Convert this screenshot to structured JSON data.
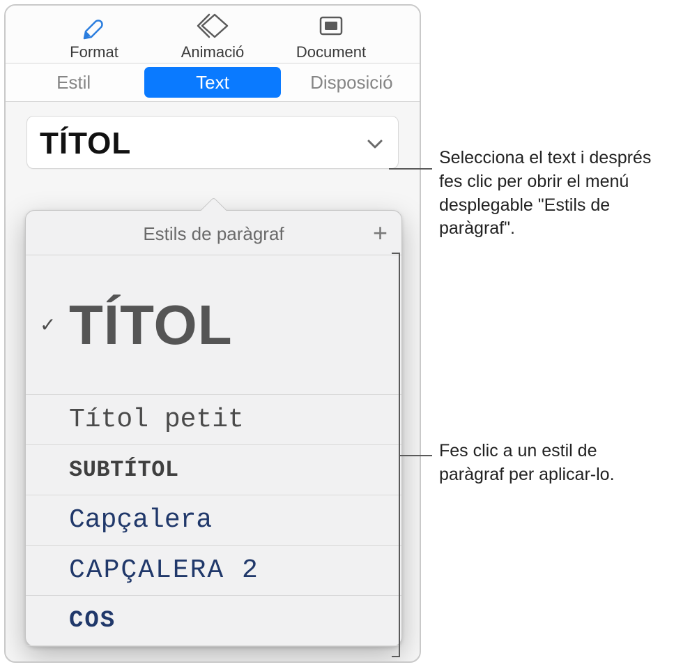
{
  "toolbar": {
    "format": "Format",
    "animation": "Animació",
    "document": "Document"
  },
  "tabs": {
    "style": "Estil",
    "text": "Text",
    "layout": "Disposició"
  },
  "selector": {
    "current": "TÍTOL"
  },
  "popover": {
    "title": "Estils de paràgraf",
    "plus": "+",
    "items": [
      {
        "label": "TÍTOL",
        "selected": true,
        "class": "s-titol",
        "big": true
      },
      {
        "label": "Títol petit",
        "selected": false,
        "class": "s-titol-petit"
      },
      {
        "label": "SUBTÍTOL",
        "selected": false,
        "class": "s-subtitol"
      },
      {
        "label": "Capçalera",
        "selected": false,
        "class": "s-capcalera"
      },
      {
        "label": "CAPÇALERA 2",
        "selected": false,
        "class": "s-capcalera2"
      },
      {
        "label": "COS",
        "selected": false,
        "class": "s-cos"
      }
    ]
  },
  "callouts": {
    "c1": "Selecciona el text i després fes clic per obrir el menú desplegable \"Estils de paràgraf\".",
    "c2": "Fes clic a un estil de paràgraf per aplicar-lo."
  }
}
